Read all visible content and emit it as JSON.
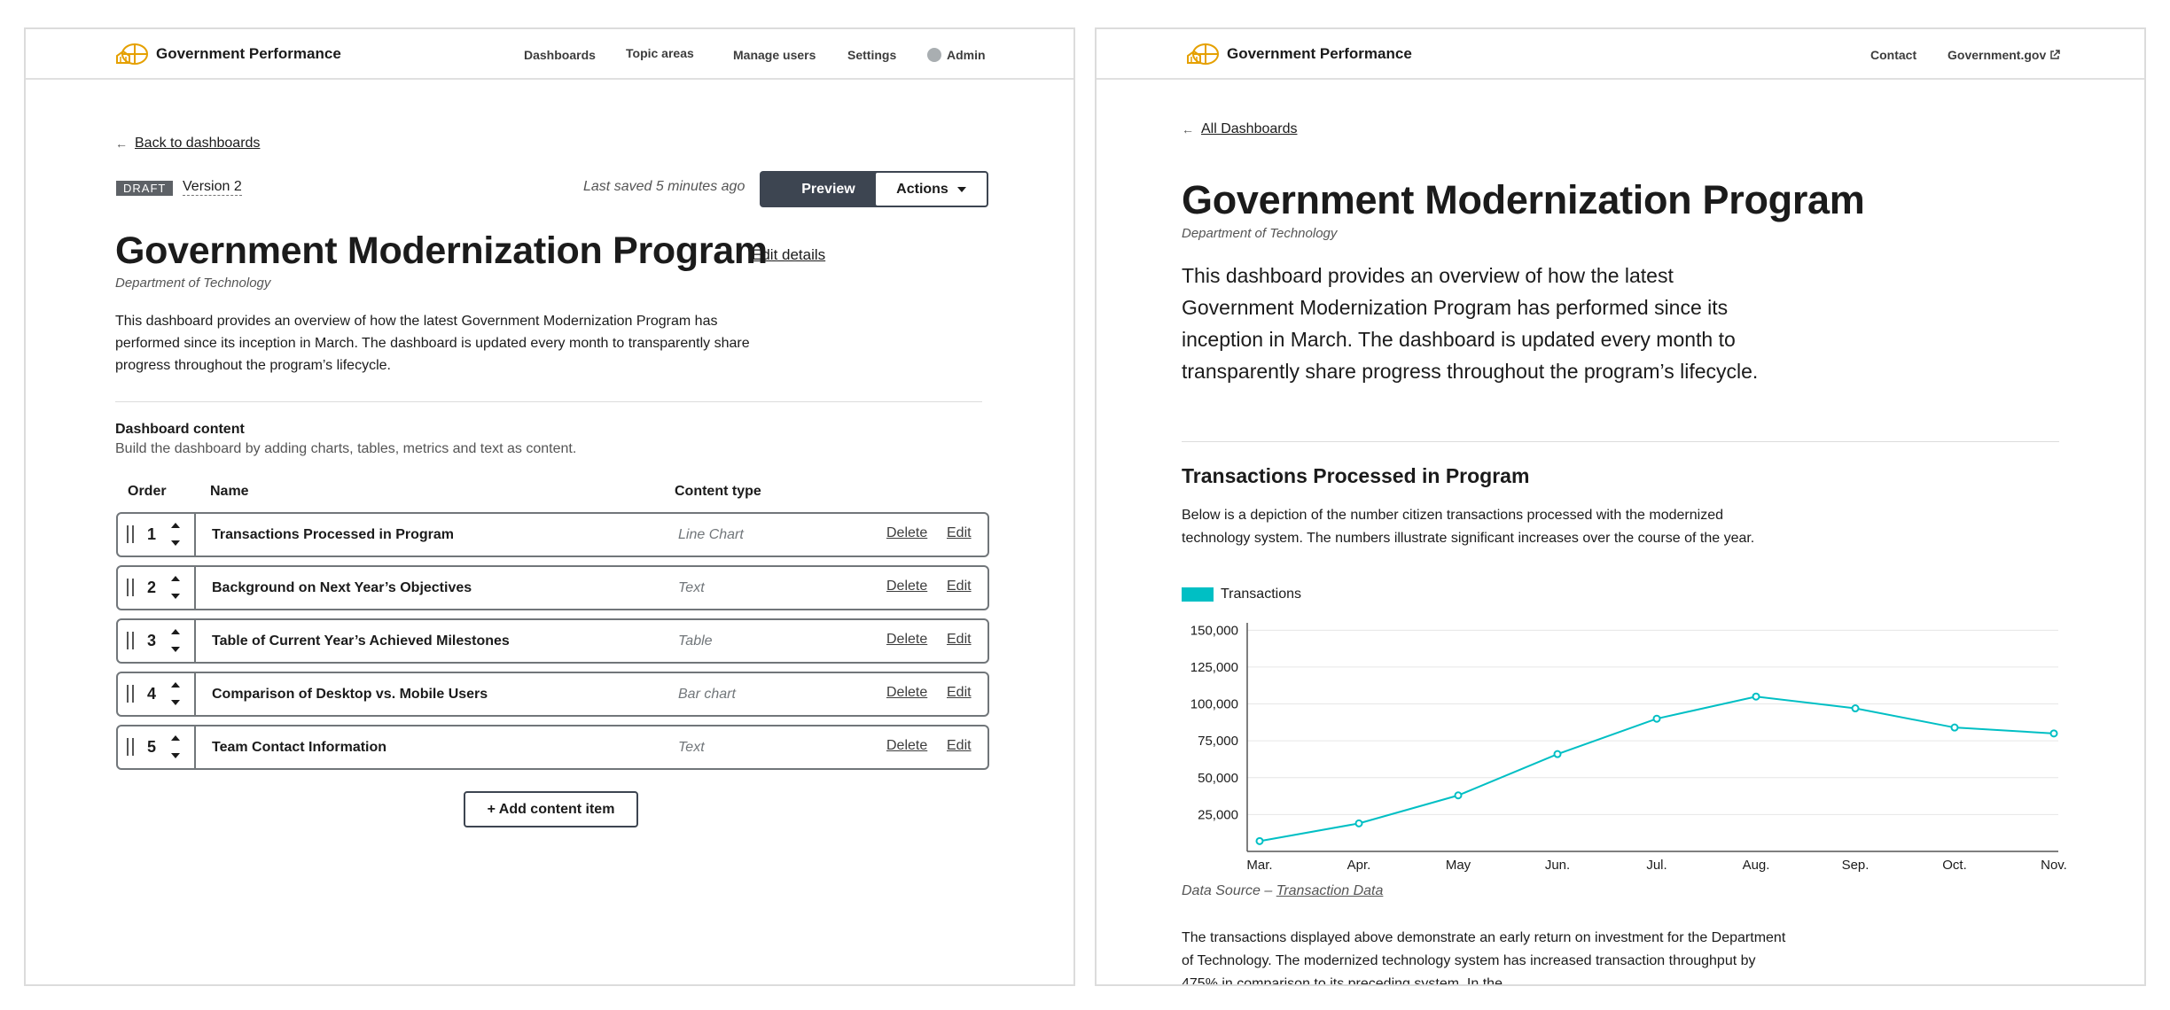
{
  "brand": {
    "name": "Government Performance"
  },
  "admin": {
    "nav": {
      "dashboards": "Dashboards",
      "topic_areas": "Topic areas",
      "manage_users": "Manage users",
      "settings": "Settings",
      "admin": "Admin"
    },
    "back_link": "Back to dashboards",
    "status_badge": "DRAFT",
    "version": "Version 2",
    "last_saved": "Last saved 5 minutes ago",
    "preview_label": "Preview",
    "actions_label": "Actions",
    "title": "Government Modernization Program",
    "edit_details": "Edit details",
    "org": "Department of Technology",
    "description": "This dashboard provides an overview of how the latest Government Modernization Program has performed since its inception in March. The dashboard is updated every month to transparently share progress throughout the program’s lifecycle.",
    "content_title": "Dashboard content",
    "content_subtitle": "Build the dashboard by adding charts, tables, metrics and text as content.",
    "columns": {
      "order": "Order",
      "name": "Name",
      "type": "Content type"
    },
    "rows": [
      {
        "order": "1",
        "name": "Transactions Processed in Program",
        "type": "Line Chart",
        "delete": "Delete",
        "edit": "Edit"
      },
      {
        "order": "2",
        "name": "Background on Next Year’s Objectives",
        "type": "Text",
        "delete": "Delete",
        "edit": "Edit"
      },
      {
        "order": "3",
        "name": "Table of Current Year’s Achieved Milestones",
        "type": "Table",
        "delete": "Delete",
        "edit": "Edit"
      },
      {
        "order": "4",
        "name": "Comparison of Desktop vs. Mobile Users",
        "type": "Bar chart",
        "delete": "Delete",
        "edit": "Edit"
      },
      {
        "order": "5",
        "name": "Team Contact Information",
        "type": "Text",
        "delete": "Delete",
        "edit": "Edit"
      }
    ],
    "add_label": "+ Add content item"
  },
  "public": {
    "nav": {
      "contact": "Contact",
      "government": "Government.gov"
    },
    "back_link": "All Dashboards",
    "title": "Government Modernization Program",
    "org": "Department of Technology",
    "description": "This dashboard provides an overview of how the latest Government Modernization Program has performed since its inception in March. The dashboard is updated every month to transparently share progress throughout the program’s lifecycle.",
    "section_title": "Transactions Processed in Program",
    "section_text": "Below is a depiction of the number citizen transactions processed with the modernized technology system. The numbers illustrate significant increases over the course of the year.",
    "source_prefix": "Data Source – ",
    "source_link": "Transaction Data",
    "footer_text": "The transactions displayed above demonstrate an early return on investment for the Department of Technology. The modernized technology system has increased transaction throughput by 475% in comparison to its preceding system. In the"
  },
  "colors": {
    "accent": "#00bfc4",
    "logo": "#e5a000",
    "button_dark": "#3d4551"
  },
  "chart_data": {
    "type": "line",
    "categories": [
      "Mar.",
      "Apr.",
      "May",
      "Jun.",
      "Jul.",
      "Aug.",
      "Sep.",
      "Oct.",
      "Nov."
    ],
    "series": [
      {
        "name": "Transactions",
        "values": [
          7000,
          19000,
          38000,
          66000,
          90000,
          105000,
          97000,
          84000,
          80000
        ]
      }
    ],
    "yticks": [
      "25,000",
      "50,000",
      "75,000",
      "100,000",
      "125,000",
      "150,000"
    ],
    "ylim": [
      0,
      155000
    ],
    "grid": true,
    "legend": "top-left"
  }
}
